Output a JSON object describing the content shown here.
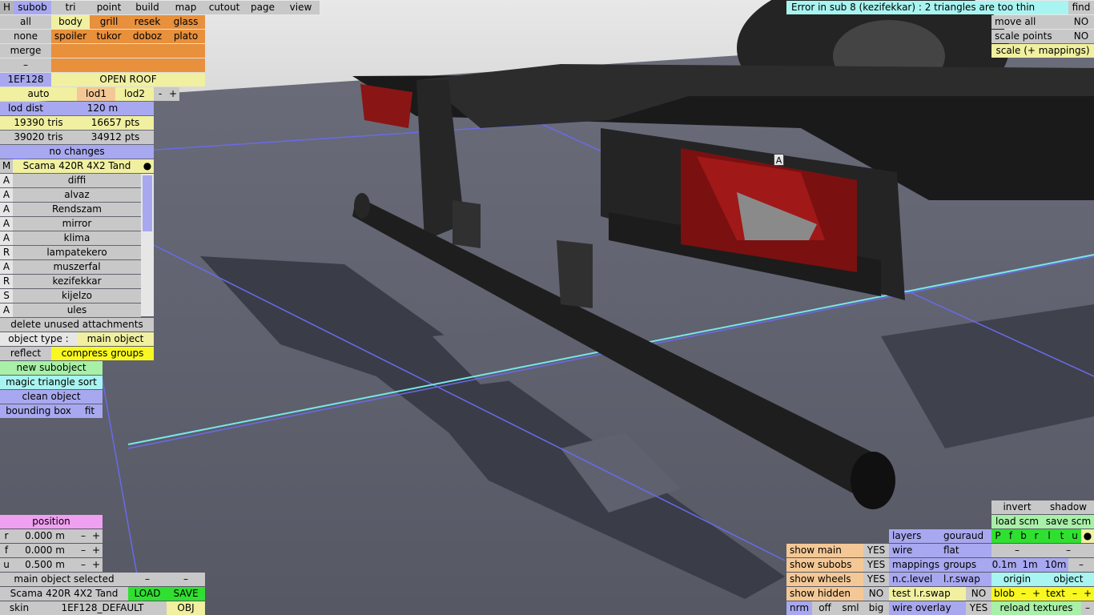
{
  "top_menu": [
    {
      "name": "menu-h",
      "label": "H"
    },
    {
      "name": "menu-subob",
      "label": "subob"
    },
    {
      "name": "menu-tri",
      "label": "tri"
    },
    {
      "name": "menu-point",
      "label": "point"
    },
    {
      "name": "menu-build",
      "label": "build"
    },
    {
      "name": "menu-map",
      "label": "map"
    },
    {
      "name": "menu-cutout",
      "label": "cutout"
    },
    {
      "name": "menu-page",
      "label": "page"
    },
    {
      "name": "menu-view",
      "label": "view"
    }
  ],
  "error_message": "Error in sub 8 (kezifekkar) : 2 triangles are too thin",
  "find_label": "find",
  "right_top": {
    "move_all": "move all",
    "move_all_val": "NO",
    "scale_points": "scale points",
    "scale_points_val": "NO",
    "scale_mappings": "scale (+ mappings)"
  },
  "groups": {
    "all": "all",
    "none": "none",
    "merge": "merge",
    "dash": "–",
    "body": "body",
    "grill": "grill",
    "resek": "resek",
    "glass": "glass",
    "spoiler": "spoiler",
    "tukor": "tukor",
    "doboz": "doboz",
    "plato": "plato"
  },
  "model_code": "1EF128",
  "open_roof": "OPEN ROOF",
  "lod": {
    "auto": "auto",
    "lod1": "lod1",
    "lod2": "lod2",
    "minus": "-",
    "plus": "+"
  },
  "lod_dist_label": "lod dist",
  "lod_dist_value": "120 m",
  "stats": {
    "tris1": "19390 tris",
    "pts1": "16657 pts",
    "tris2": "39020 tris",
    "pts2": "34912 pts"
  },
  "no_changes": "no changes",
  "object_header": {
    "tag": "M",
    "name": "Scama 420R 4X2 Tand",
    "dot": "●"
  },
  "subobjects": [
    {
      "tag": "A",
      "name": "diffi"
    },
    {
      "tag": "A",
      "name": "alvaz"
    },
    {
      "tag": "A",
      "name": "Rendszam"
    },
    {
      "tag": "A",
      "name": "mirror"
    },
    {
      "tag": "A",
      "name": "klima"
    },
    {
      "tag": "R",
      "name": "lampatekero"
    },
    {
      "tag": "A",
      "name": "muszerfal"
    },
    {
      "tag": "R",
      "name": "kezifekkar"
    },
    {
      "tag": "S",
      "name": "kijelzo"
    },
    {
      "tag": "A",
      "name": "ules"
    }
  ],
  "delete_unused": "delete unused attachments",
  "object_type_label": "object type :",
  "object_type_value": "main object",
  "reflect": "reflect",
  "compress_groups": "compress groups",
  "new_subobject": "new subobject",
  "magic_sort": "magic triangle sort",
  "clean_object": "clean object",
  "bounding_box": "bounding box",
  "fit": "fit",
  "position": {
    "title": "position",
    "rows": [
      {
        "axis": "r",
        "value": "0.000 m"
      },
      {
        "axis": "f",
        "value": "0.000 m"
      },
      {
        "axis": "u",
        "value": "0.500 m"
      }
    ]
  },
  "main_object_selected": "main object selected",
  "bottom_object_name": "Scama 420R 4X2 Tand",
  "load": "LOAD",
  "save": "SAVE",
  "skin_label": "skin",
  "skin_value": "1EF128_DEFAULT",
  "obj": "OBJ",
  "view_panel": {
    "invert": "invert",
    "shadow": "shadow",
    "load_scm": "load scm",
    "save_scm": "save scm",
    "channels": [
      "P",
      "f",
      "b",
      "r",
      "l",
      "t",
      "u"
    ],
    "layers": "layers",
    "gouraud": "gouraud",
    "wire": "wire",
    "flat": "flat",
    "mappings": "mappings",
    "groups": "groups",
    "d01": "0.1m",
    "d1": "1m",
    "d10": "10m",
    "nc_level": "n.c.level",
    "lr_swap": "l.r.swap",
    "origin": "origin",
    "object": "object",
    "test_lr_swap": "test l.r.swap",
    "test_lr_val": "NO",
    "blob": "blob",
    "text": "text",
    "wire_overlay": "wire overlay",
    "wire_overlay_val": "YES",
    "reload_textures": "reload textures",
    "show_main": "show main",
    "show_main_val": "YES",
    "show_subobs": "show subobs",
    "show_subobs_val": "YES",
    "show_wheels": "show wheels",
    "show_wheels_val": "YES",
    "show_hidden": "show hidden",
    "show_hidden_val": "NO",
    "nrm": "nrm",
    "off": "off",
    "sml": "sml",
    "big": "big"
  },
  "viewport_label": "A"
}
